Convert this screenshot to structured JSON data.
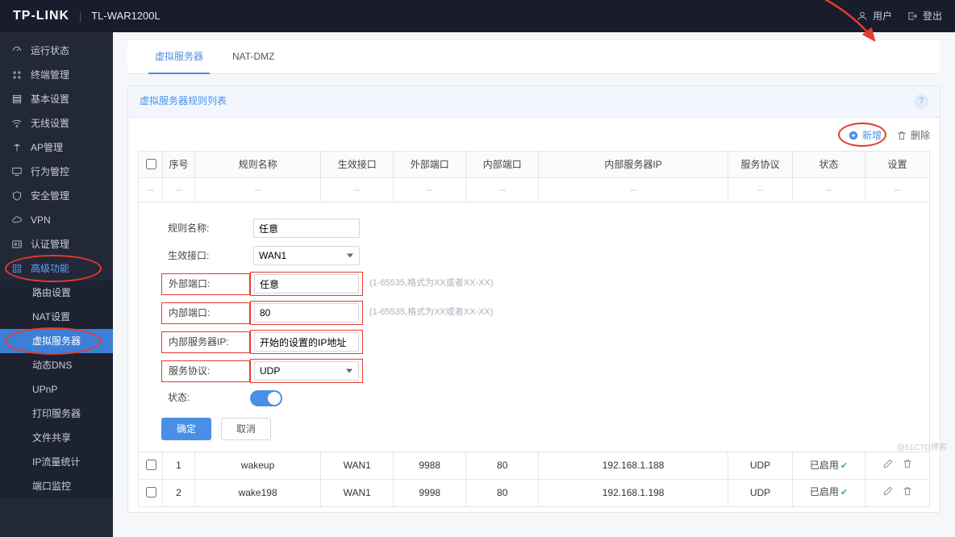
{
  "topbar": {
    "brand": "TP-LINK",
    "model": "TL-WAR1200L",
    "user_label": "用户",
    "logout_label": "登出"
  },
  "sidebar": {
    "items": [
      {
        "label": "运行状态"
      },
      {
        "label": "终端管理"
      },
      {
        "label": "基本设置"
      },
      {
        "label": "无线设置"
      },
      {
        "label": "AP管理"
      },
      {
        "label": "行为管控"
      },
      {
        "label": "安全管理"
      },
      {
        "label": "VPN"
      },
      {
        "label": "认证管理"
      },
      {
        "label": "高级功能"
      }
    ],
    "subitems": [
      {
        "label": "路由设置"
      },
      {
        "label": "NAT设置"
      },
      {
        "label": "虚拟服务器"
      },
      {
        "label": "动态DNS"
      },
      {
        "label": "UPnP"
      },
      {
        "label": "打印服务器"
      },
      {
        "label": "文件共享"
      },
      {
        "label": "IP流量统计"
      },
      {
        "label": "端口监控"
      }
    ]
  },
  "tabs": {
    "t0": "虚拟服务器",
    "t1": "NAT-DMZ"
  },
  "panel": {
    "title": "虚拟服务器规则列表"
  },
  "toolbar": {
    "add": "新增",
    "del": "删除"
  },
  "columns": {
    "c0": "序号",
    "c1": "规则名称",
    "c2": "生效接口",
    "c3": "外部端口",
    "c4": "内部端口",
    "c5": "内部服务器IP",
    "c6": "服务协议",
    "c7": "状态",
    "c8": "设置"
  },
  "empty": "--",
  "form": {
    "name_label": "规则名称:",
    "name_value": "任意",
    "iface_label": "生效接口:",
    "iface_value": "WAN1",
    "ext_label": "外部端口:",
    "ext_value": "任意",
    "ext_hint": "(1-65535,格式为XX或者XX-XX)",
    "int_label": "内部端口:",
    "int_value": "80",
    "int_hint": "(1-65535,格式为XX或者XX-XX)",
    "ip_label": "内部服务器IP:",
    "ip_value": "开始的设置的IP地址",
    "proto_label": "服务协议:",
    "proto_value": "UDP",
    "state_label": "状态:",
    "ok": "确定",
    "cancel": "取消"
  },
  "rows": [
    {
      "idx": "1",
      "name": "wakeup",
      "iface": "WAN1",
      "ext": "9988",
      "int": "80",
      "ip": "192.168.1.188",
      "proto": "UDP",
      "state": "已启用"
    },
    {
      "idx": "2",
      "name": "wake198",
      "iface": "WAN1",
      "ext": "9998",
      "int": "80",
      "ip": "192.168.1.198",
      "proto": "UDP",
      "state": "已启用"
    }
  ],
  "watermark": "@51CTO博客"
}
